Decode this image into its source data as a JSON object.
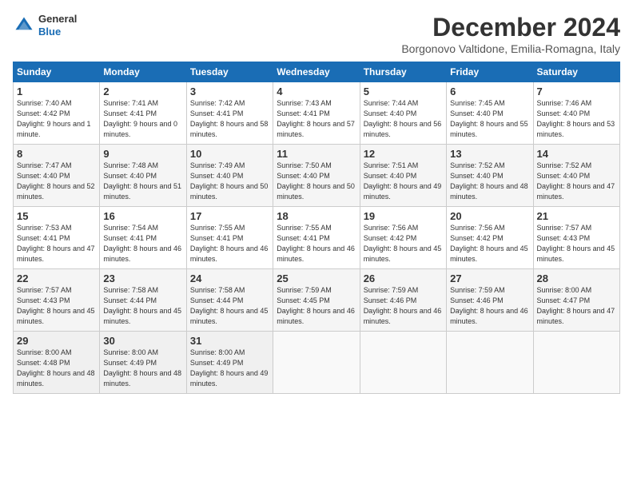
{
  "header": {
    "logo_general": "General",
    "logo_blue": "Blue",
    "title": "December 2024",
    "location": "Borgonovo Valtidone, Emilia-Romagna, Italy"
  },
  "days_of_week": [
    "Sunday",
    "Monday",
    "Tuesday",
    "Wednesday",
    "Thursday",
    "Friday",
    "Saturday"
  ],
  "weeks": [
    [
      {
        "day": "1",
        "sunrise": "Sunrise: 7:40 AM",
        "sunset": "Sunset: 4:42 PM",
        "daylight": "Daylight: 9 hours and 1 minute."
      },
      {
        "day": "2",
        "sunrise": "Sunrise: 7:41 AM",
        "sunset": "Sunset: 4:41 PM",
        "daylight": "Daylight: 9 hours and 0 minutes."
      },
      {
        "day": "3",
        "sunrise": "Sunrise: 7:42 AM",
        "sunset": "Sunset: 4:41 PM",
        "daylight": "Daylight: 8 hours and 58 minutes."
      },
      {
        "day": "4",
        "sunrise": "Sunrise: 7:43 AM",
        "sunset": "Sunset: 4:41 PM",
        "daylight": "Daylight: 8 hours and 57 minutes."
      },
      {
        "day": "5",
        "sunrise": "Sunrise: 7:44 AM",
        "sunset": "Sunset: 4:40 PM",
        "daylight": "Daylight: 8 hours and 56 minutes."
      },
      {
        "day": "6",
        "sunrise": "Sunrise: 7:45 AM",
        "sunset": "Sunset: 4:40 PM",
        "daylight": "Daylight: 8 hours and 55 minutes."
      },
      {
        "day": "7",
        "sunrise": "Sunrise: 7:46 AM",
        "sunset": "Sunset: 4:40 PM",
        "daylight": "Daylight: 8 hours and 53 minutes."
      }
    ],
    [
      {
        "day": "8",
        "sunrise": "Sunrise: 7:47 AM",
        "sunset": "Sunset: 4:40 PM",
        "daylight": "Daylight: 8 hours and 52 minutes."
      },
      {
        "day": "9",
        "sunrise": "Sunrise: 7:48 AM",
        "sunset": "Sunset: 4:40 PM",
        "daylight": "Daylight: 8 hours and 51 minutes."
      },
      {
        "day": "10",
        "sunrise": "Sunrise: 7:49 AM",
        "sunset": "Sunset: 4:40 PM",
        "daylight": "Daylight: 8 hours and 50 minutes."
      },
      {
        "day": "11",
        "sunrise": "Sunrise: 7:50 AM",
        "sunset": "Sunset: 4:40 PM",
        "daylight": "Daylight: 8 hours and 50 minutes."
      },
      {
        "day": "12",
        "sunrise": "Sunrise: 7:51 AM",
        "sunset": "Sunset: 4:40 PM",
        "daylight": "Daylight: 8 hours and 49 minutes."
      },
      {
        "day": "13",
        "sunrise": "Sunrise: 7:52 AM",
        "sunset": "Sunset: 4:40 PM",
        "daylight": "Daylight: 8 hours and 48 minutes."
      },
      {
        "day": "14",
        "sunrise": "Sunrise: 7:52 AM",
        "sunset": "Sunset: 4:40 PM",
        "daylight": "Daylight: 8 hours and 47 minutes."
      }
    ],
    [
      {
        "day": "15",
        "sunrise": "Sunrise: 7:53 AM",
        "sunset": "Sunset: 4:41 PM",
        "daylight": "Daylight: 8 hours and 47 minutes."
      },
      {
        "day": "16",
        "sunrise": "Sunrise: 7:54 AM",
        "sunset": "Sunset: 4:41 PM",
        "daylight": "Daylight: 8 hours and 46 minutes."
      },
      {
        "day": "17",
        "sunrise": "Sunrise: 7:55 AM",
        "sunset": "Sunset: 4:41 PM",
        "daylight": "Daylight: 8 hours and 46 minutes."
      },
      {
        "day": "18",
        "sunrise": "Sunrise: 7:55 AM",
        "sunset": "Sunset: 4:41 PM",
        "daylight": "Daylight: 8 hours and 46 minutes."
      },
      {
        "day": "19",
        "sunrise": "Sunrise: 7:56 AM",
        "sunset": "Sunset: 4:42 PM",
        "daylight": "Daylight: 8 hours and 45 minutes."
      },
      {
        "day": "20",
        "sunrise": "Sunrise: 7:56 AM",
        "sunset": "Sunset: 4:42 PM",
        "daylight": "Daylight: 8 hours and 45 minutes."
      },
      {
        "day": "21",
        "sunrise": "Sunrise: 7:57 AM",
        "sunset": "Sunset: 4:43 PM",
        "daylight": "Daylight: 8 hours and 45 minutes."
      }
    ],
    [
      {
        "day": "22",
        "sunrise": "Sunrise: 7:57 AM",
        "sunset": "Sunset: 4:43 PM",
        "daylight": "Daylight: 8 hours and 45 minutes."
      },
      {
        "day": "23",
        "sunrise": "Sunrise: 7:58 AM",
        "sunset": "Sunset: 4:44 PM",
        "daylight": "Daylight: 8 hours and 45 minutes."
      },
      {
        "day": "24",
        "sunrise": "Sunrise: 7:58 AM",
        "sunset": "Sunset: 4:44 PM",
        "daylight": "Daylight: 8 hours and 45 minutes."
      },
      {
        "day": "25",
        "sunrise": "Sunrise: 7:59 AM",
        "sunset": "Sunset: 4:45 PM",
        "daylight": "Daylight: 8 hours and 46 minutes."
      },
      {
        "day": "26",
        "sunrise": "Sunrise: 7:59 AM",
        "sunset": "Sunset: 4:46 PM",
        "daylight": "Daylight: 8 hours and 46 minutes."
      },
      {
        "day": "27",
        "sunrise": "Sunrise: 7:59 AM",
        "sunset": "Sunset: 4:46 PM",
        "daylight": "Daylight: 8 hours and 46 minutes."
      },
      {
        "day": "28",
        "sunrise": "Sunrise: 8:00 AM",
        "sunset": "Sunset: 4:47 PM",
        "daylight": "Daylight: 8 hours and 47 minutes."
      }
    ],
    [
      {
        "day": "29",
        "sunrise": "Sunrise: 8:00 AM",
        "sunset": "Sunset: 4:48 PM",
        "daylight": "Daylight: 8 hours and 48 minutes."
      },
      {
        "day": "30",
        "sunrise": "Sunrise: 8:00 AM",
        "sunset": "Sunset: 4:49 PM",
        "daylight": "Daylight: 8 hours and 48 minutes."
      },
      {
        "day": "31",
        "sunrise": "Sunrise: 8:00 AM",
        "sunset": "Sunset: 4:49 PM",
        "daylight": "Daylight: 8 hours and 49 minutes."
      },
      null,
      null,
      null,
      null
    ]
  ]
}
